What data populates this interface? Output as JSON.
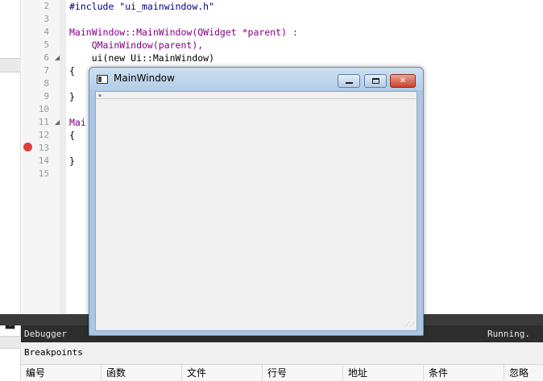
{
  "editor": {
    "lines": [
      {
        "no": "2",
        "code": "#include \"ui_mainwindow.h\""
      },
      {
        "no": "3",
        "code": ""
      },
      {
        "no": "4",
        "code": "MainWindow::MainWindow(QWidget *parent) :"
      },
      {
        "no": "5",
        "code": "    QMainWindow(parent),"
      },
      {
        "no": "6",
        "code": "    ui(new Ui::MainWindow)"
      },
      {
        "no": "7",
        "code": "{"
      },
      {
        "no": "8",
        "code": ""
      },
      {
        "no": "9",
        "code": "}"
      },
      {
        "no": "10",
        "code": ""
      },
      {
        "no": "11",
        "code": "Mai"
      },
      {
        "no": "12",
        "code": "{"
      },
      {
        "no": "13",
        "code": ""
      },
      {
        "no": "14",
        "code": "}"
      },
      {
        "no": "15",
        "code": ""
      }
    ],
    "breakpoint_line": "13"
  },
  "mainwindow": {
    "title": "MainWindow",
    "buttons": {
      "minimize": "minimize-icon",
      "maximize": "maximize-icon",
      "close": "✕"
    }
  },
  "debugger": {
    "label": "Debugger",
    "status": "Running."
  },
  "breakpoints": {
    "title": "Breakpoints",
    "columns": [
      "编号",
      "函数",
      "文件",
      "行号",
      "地址",
      "条件",
      "忽略"
    ]
  },
  "colors": {
    "breakpoint": "#e03c3c",
    "keyword": "#00007f",
    "type": "#800080",
    "string": "#008000",
    "debugger_bar": "#2d2d2d"
  }
}
